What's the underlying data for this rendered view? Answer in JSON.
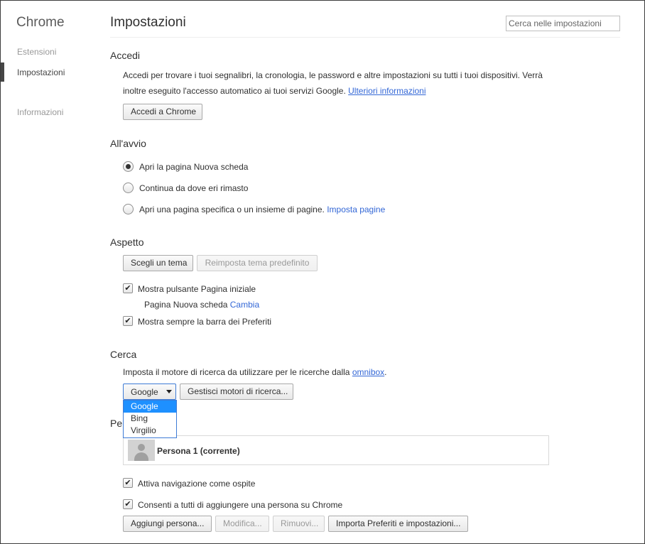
{
  "sidebar": {
    "title": "Chrome",
    "items": [
      {
        "label": "Estensioni",
        "active": false
      },
      {
        "label": "Impostazioni",
        "active": true
      },
      {
        "label": "Informazioni",
        "active": false
      }
    ]
  },
  "header": {
    "title": "Impostazioni",
    "search_placeholder": "Cerca nelle impostazioni"
  },
  "accedi": {
    "heading": "Accedi",
    "description_line1": "Accedi per trovare i tuoi segnalibri, la cronologia, le password e altre impostazioni su tutti i tuoi dispositivi. Verrà",
    "description_line2": "inoltre eseguito l'accesso automatico ai tuoi servizi Google.",
    "more_info_link": "Ulteriori informazioni",
    "signin_button": "Accedi a Chrome"
  },
  "avvio": {
    "heading": "All'avvio",
    "options": [
      {
        "label": "Apri la pagina Nuova scheda",
        "checked": true
      },
      {
        "label": "Continua da dove eri rimasto",
        "checked": false
      },
      {
        "label": "Apri una pagina specifica o un insieme di pagine.",
        "checked": false,
        "link": "Imposta pagine"
      }
    ]
  },
  "aspetto": {
    "heading": "Aspetto",
    "theme_button": "Scegli un tema",
    "reset_theme_button": "Reimposta tema predefinito",
    "show_home_label": "Mostra pulsante Pagina iniziale",
    "show_home_checked": true,
    "home_page_text": "Pagina Nuova scheda",
    "home_page_change_link": "Cambia",
    "bookmarks_bar_label": "Mostra sempre la barra dei Preferiti",
    "bookmarks_bar_checked": true
  },
  "cerca": {
    "heading": "Cerca",
    "description": "Imposta il motore di ricerca da utilizzare per le ricerche dalla",
    "omnibox_link": "omnibox",
    "description_end": ".",
    "engine_selected": "Google",
    "engine_options": [
      "Google",
      "Bing",
      "Virgilio"
    ],
    "manage_button": "Gestisci motori di ricerca..."
  },
  "persone": {
    "heading_partial": "Per",
    "current_person": "Persona 1 (corrente)",
    "guest_label": "Attiva navigazione come ospite",
    "guest_checked": true,
    "allow_add_label": "Consenti a tutti di aggiungere una persona su Chrome",
    "allow_add_checked": true,
    "add_button": "Aggiungi persona...",
    "edit_button": "Modifica...",
    "remove_button": "Rimuovi...",
    "import_button": "Importa Preferiti e impostazioni..."
  },
  "icons": {
    "check_glyph": "✔"
  }
}
